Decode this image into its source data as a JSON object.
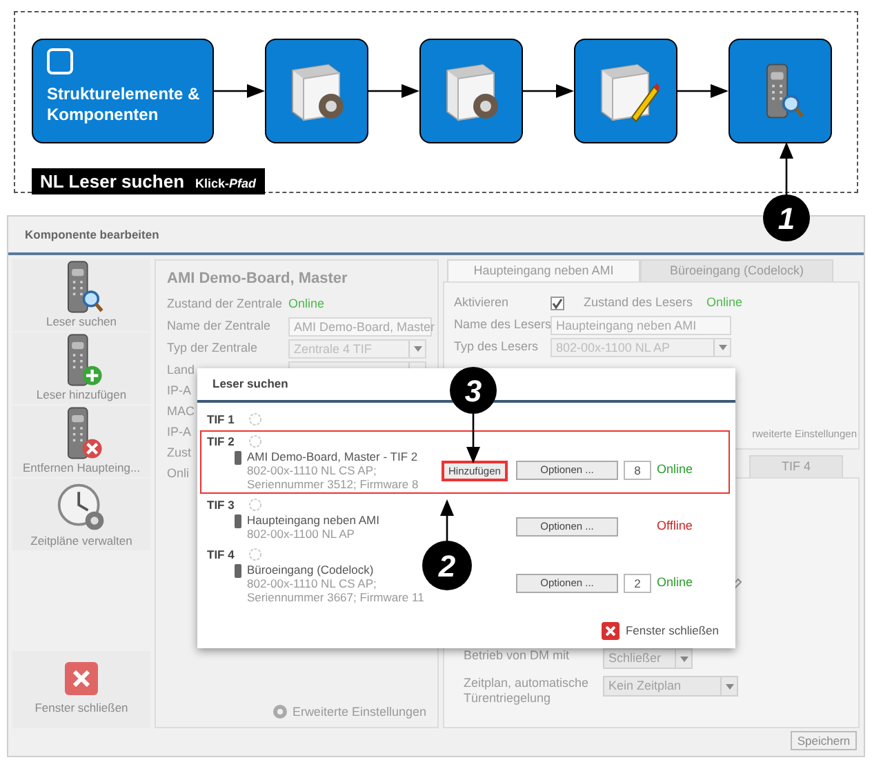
{
  "flow": {
    "steps": [
      {
        "kind": "text",
        "label": "Strukturelemente & Komponenten"
      },
      {
        "kind": "module-gear"
      },
      {
        "kind": "module-gear"
      },
      {
        "kind": "module-pencil"
      },
      {
        "kind": "reader-search"
      }
    ],
    "caption": {
      "title": "NL Leser suchen",
      "subtitle": "Klick-*Pfad*"
    }
  },
  "window": {
    "title": "Komponente bearbeiten",
    "sidebar": [
      {
        "kind": "search",
        "label": "Leser suchen"
      },
      {
        "kind": "add",
        "label": "Leser hinzufügen"
      },
      {
        "kind": "remove",
        "label": "Entfernen Haupteing..."
      },
      {
        "kind": "clock",
        "label": "Zeitpläne verwalten"
      }
    ],
    "close": "Fenster schließen",
    "central": {
      "title": "AMI Demo-Board, Master",
      "fields": [
        {
          "kind": "status",
          "label": "Zustand der Zentrale",
          "value": "Online"
        },
        {
          "kind": "text",
          "label": "Name der Zentrale",
          "value": "AMI Demo-Board, Master"
        },
        {
          "kind": "select",
          "label": "Typ der Zentrale",
          "value": "Zentrale 4 TIF"
        },
        {
          "kind": "select",
          "label": "Land"
        },
        {
          "kind": "label",
          "label": "IP-A"
        },
        {
          "kind": "label",
          "label": "MAC"
        },
        {
          "kind": "label",
          "label": "IP-A"
        },
        {
          "kind": "label",
          "label": "Zust"
        },
        {
          "kind": "label",
          "label": "Onli"
        }
      ],
      "advanced": "Erweiterte Einstellungen"
    },
    "reader": {
      "tabs": [
        {
          "label": "Haupteingang neben AMI",
          "selected": true
        },
        {
          "label": "Büroeingang (Codelock)",
          "selected": false
        }
      ],
      "activate": {
        "label": "Aktivieren",
        "checked": true
      },
      "state_label": "Zustand des Lesers",
      "state": "Online",
      "fields": [
        {
          "kind": "text",
          "label": "Name des Lesers",
          "value": "Haupteingang neben AMI"
        },
        {
          "kind": "select",
          "label": "Typ des Lesers",
          "value": "802-00x-1100 NL AP"
        }
      ],
      "advanced": "rweiterte Einstellungen",
      "tif_tab": "TIF 4",
      "lower_fields": [
        {
          "kind": "select",
          "label": "Betrieb von DM mit",
          "value": "Schließer"
        },
        {
          "kind": "select",
          "label": "Zeitplan, automatische Türentriegelung",
          "value": "Kein Zeitplan"
        }
      ]
    },
    "save": "Speichern"
  },
  "dialog": {
    "title": "Leser suchen",
    "rows": [
      {
        "tif": "TIF 1",
        "highlighted": false
      },
      {
        "tif": "TIF 2",
        "highlighted": true,
        "reader": "AMI Demo-Board, Master - TIF 2",
        "details": [
          "802-00x-1110 NL CS AP;",
          "Seriennummer 3512; Firmware 8"
        ],
        "add_button": {
          "label": "Hinzufügen",
          "highlighted": true
        },
        "options": "Optionen ...",
        "number": "8",
        "status": "Online",
        "color": "#2a9d2a"
      },
      {
        "tif": "TIF 3",
        "highlighted": false,
        "reader": "Haupteingang neben AMI",
        "details": [
          "802-00x-1100 NL AP"
        ],
        "options": "Optionen ...",
        "status": "Offline",
        "color": "#cc2222"
      },
      {
        "tif": "TIF 4",
        "highlighted": false,
        "reader": "Büroeingang (Codelock)",
        "details": [
          "802-00x-1110 NL CS AP;",
          "Seriennummer 3667; Firmware 11"
        ],
        "options": "Optionen ...",
        "number": "2",
        "status": "Online",
        "color": "#2a9d2a"
      }
    ],
    "close": "Fenster schließen"
  },
  "callouts": [
    {
      "number": "1"
    },
    {
      "number": "2"
    },
    {
      "number": "3"
    }
  ]
}
